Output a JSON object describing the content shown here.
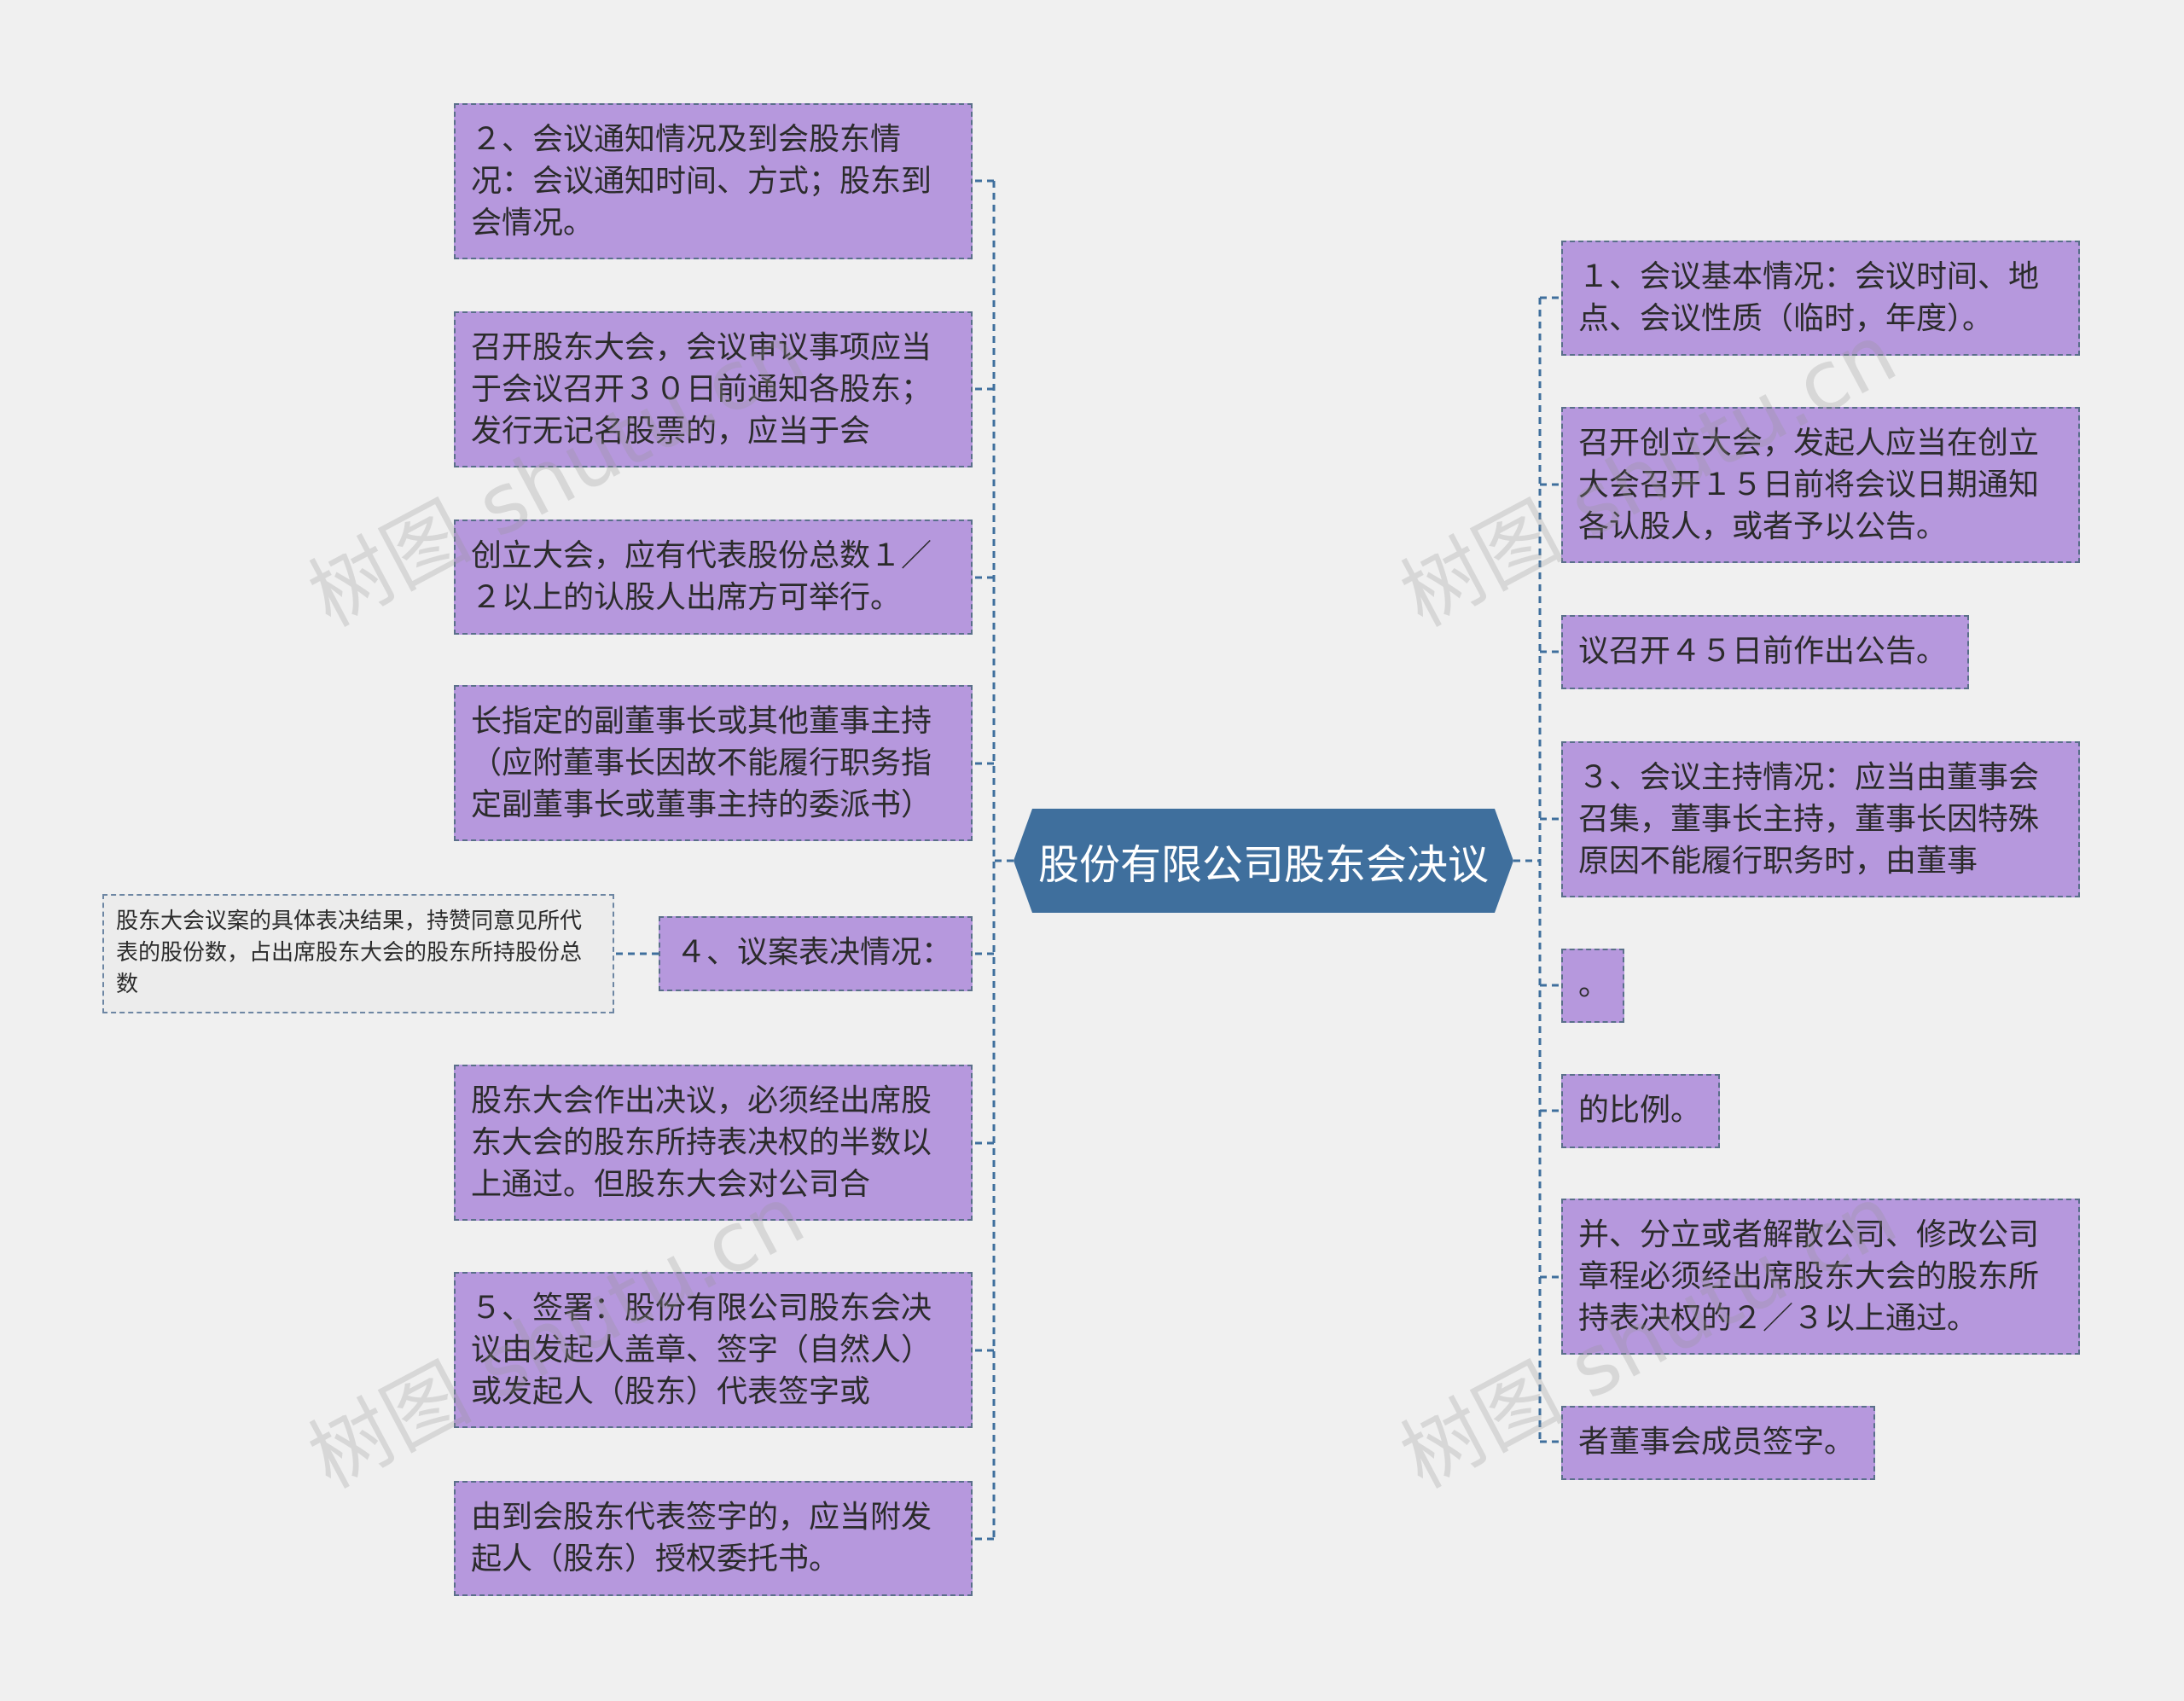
{
  "central": "股份有限公司股东会决议",
  "left": [
    "２、会议通知情况及到会股东情况：会议通知时间、方式；股东到会情况。",
    "召开股东大会，会议审议事项应当于会议召开３０日前通知各股东；发行无记名股票的，应当于会",
    "创立大会，应有代表股份总数１／２以上的认股人出席方可举行。",
    "长指定的副董事长或其他董事主持（应附董事长因故不能履行职务指定副董事长或董事主持的委派书）",
    "４、议案表决情况：",
    "股东大会作出决议，必须经出席股东大会的股东所持表决权的半数以上通过。但股东大会对公司合",
    "５、签署：股份有限公司股东会决议由发起人盖章、签字（自然人）或发起人（股东）代表签字或",
    "由到会股东代表签字的，应当附发起人（股东）授权委托书。"
  ],
  "left_leaf": "股东大会议案的具体表决结果，持赞同意见所代表的股份数，占出席股东大会的股东所持股份总数",
  "right": [
    "１、会议基本情况：会议时间、地点、会议性质（临时，年度）。",
    "召开创立大会，发起人应当在创立大会召开１５日前将会议日期通知各认股人，或者予以公告。",
    "议召开４５日前作出公告。",
    "３、会议主持情况：应当由董事会召集，董事长主持，董事长因特殊原因不能履行职务时，由董事",
    "。",
    "的比例。",
    "并、分立或者解散公司、修改公司章程必须经出席股东大会的股东所持表决权的２／３以上通过。",
    "者董事会成员签字。"
  ],
  "watermarks": [
    "树图 shutu.cn",
    "树图 shutu.cn",
    "树图 shutu.cn",
    "树图 shutu.cn"
  ],
  "colors": {
    "node_fill": "#b698dd",
    "central_fill": "#3f6f9d",
    "connector": "#3f6f9d",
    "background": "#f0f0f0"
  }
}
